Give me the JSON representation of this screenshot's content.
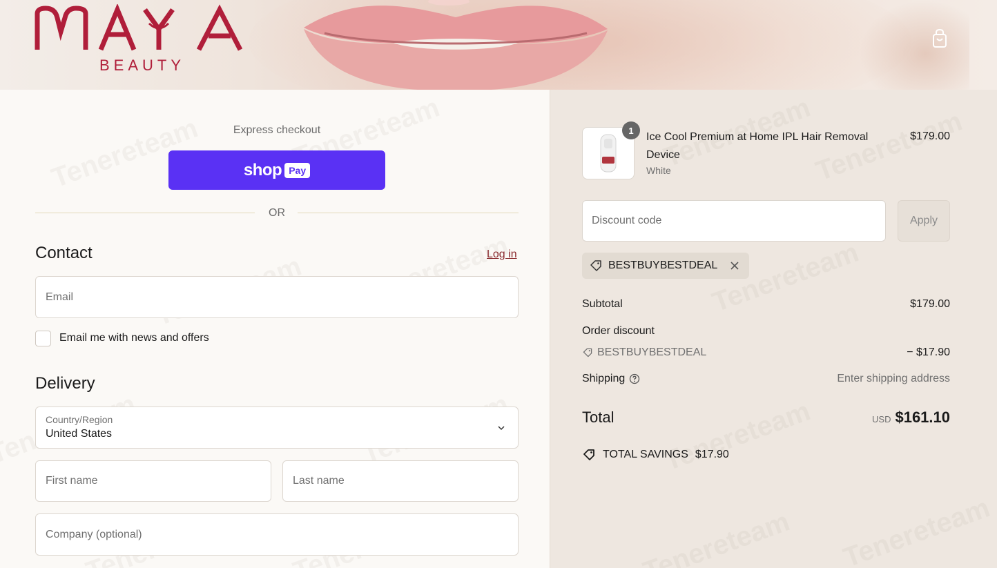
{
  "header": {
    "logo_main": "MAYA",
    "logo_sub": "BEAUTY",
    "cart_icon": "shopping-bag-icon"
  },
  "express": {
    "label": "Express checkout",
    "shop_pay_word": "shop",
    "shop_pay_chip": "Pay",
    "or_text": "OR"
  },
  "contact": {
    "title": "Contact",
    "login_label": "Log in",
    "email_placeholder": "Email",
    "newsletter_label": "Email me with news and offers"
  },
  "delivery": {
    "title": "Delivery",
    "country_label": "Country/Region",
    "country_value": "United States",
    "first_name_placeholder": "First name",
    "last_name_placeholder": "Last name",
    "company_placeholder": "Company (optional)"
  },
  "summary": {
    "product": {
      "quantity": "1",
      "name": "Ice Cool Premium at Home IPL Hair Removal Device",
      "variant": "White",
      "price": "$179.00"
    },
    "discount_placeholder": "Discount code",
    "apply_label": "Apply",
    "applied_code": "BESTBUYBESTDEAL",
    "subtotal_label": "Subtotal",
    "subtotal_value": "$179.00",
    "order_discount_label": "Order discount",
    "order_discount_code": "BESTBUYBESTDEAL",
    "order_discount_value": "− $17.90",
    "shipping_label": "Shipping",
    "shipping_value": "Enter shipping address",
    "total_label": "Total",
    "total_currency": "USD",
    "total_value": "$161.10",
    "savings_label": "TOTAL SAVINGS",
    "savings_value": "$17.90"
  },
  "watermark": "Tenereteam",
  "colors": {
    "brand_red": "#b01e3a",
    "shop_pay_purple": "#5a31f4",
    "link": "#8a2a2e"
  }
}
